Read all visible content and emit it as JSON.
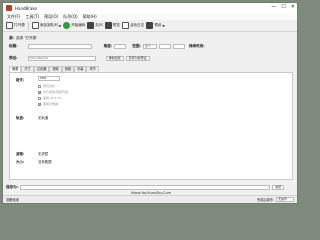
{
  "window": {
    "title": "HandBrake",
    "min": "—",
    "max": "☐",
    "close": "✕"
  },
  "menu": [
    "文件(F)",
    "工具(T)",
    "预设(O)",
    "队列(Q)",
    "帮助(H)"
  ],
  "toolbar": {
    "open": "打开源",
    "add_queue": "添加到队列",
    "start": "开始编码",
    "queue": "队列",
    "preview": "预览",
    "activity": "活动日志",
    "presets": "预设"
  },
  "source": {
    "label": "源:",
    "value": "选择 '打开源' "
  },
  "title_row": {
    "title_label": "标题:",
    "angle_label": "角度:",
    "range_label": "范围:",
    "range_select": "章节",
    "duration_label": "持续时间:"
  },
  "preset_row": {
    "label": "预设:",
    "value": "Fast 480p30",
    "reload": "重新加载",
    "save": "另存为新预设"
  },
  "tabs": [
    "摘要",
    "尺寸",
    "过滤器",
    "视频",
    "音频",
    "字幕",
    "章节"
  ],
  "summary": {
    "format_label": "格式:",
    "format_value": "MP4",
    "opt_web": "网页优化",
    "opt_ipod": "兼容 iPod 5G",
    "opt_align": "对齐音频/视频开始",
    "opt_passthru": "保留元数据",
    "tracks_label": "轨道:",
    "tracks_value": "无轨道",
    "filters_label": "滤镜:",
    "filters_value": "无滤镜",
    "size_label": "大小:",
    "size_value": "没有数据"
  },
  "save_as": {
    "label": "保存为:",
    "browse": "浏览"
  },
  "status": {
    "ready": "准备就绪",
    "when_done_label": "完成后操作:",
    "when_done_value": "无操作"
  },
  "watermark": "Www.YouYuanSky.Com"
}
